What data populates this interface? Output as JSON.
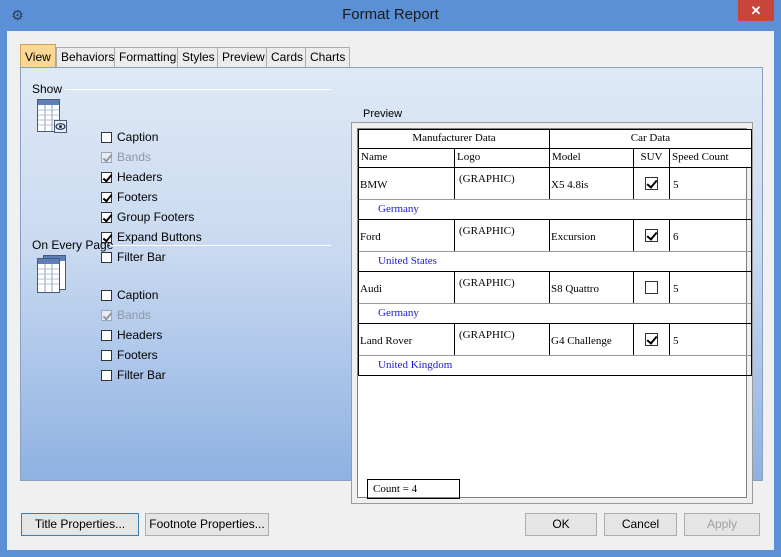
{
  "window": {
    "title": "Format Report",
    "close_glyph": "✕",
    "app_icon": "gear-icon"
  },
  "tabs": [
    {
      "label": "View"
    },
    {
      "label": "Behaviors"
    },
    {
      "label": "Formatting"
    },
    {
      "label": "Styles"
    },
    {
      "label": "Preview"
    },
    {
      "label": "Cards"
    },
    {
      "label": "Charts"
    }
  ],
  "show": {
    "label": "Show",
    "items": [
      {
        "label": "Caption",
        "checked": false,
        "disabled": false
      },
      {
        "label": "Bands",
        "checked": true,
        "disabled": true
      },
      {
        "label": "Headers",
        "checked": true,
        "disabled": false
      },
      {
        "label": "Footers",
        "checked": true,
        "disabled": false
      },
      {
        "label": "Group Footers",
        "checked": true,
        "disabled": false
      },
      {
        "label": "Expand Buttons",
        "checked": true,
        "disabled": false
      },
      {
        "label": "Filter Bar",
        "checked": false,
        "disabled": false
      }
    ]
  },
  "every_page": {
    "label": "On Every Page",
    "items": [
      {
        "label": "Caption",
        "checked": false,
        "disabled": false
      },
      {
        "label": "Bands",
        "checked": true,
        "disabled": true
      },
      {
        "label": "Headers",
        "checked": false,
        "disabled": false
      },
      {
        "label": "Footers",
        "checked": false,
        "disabled": false
      },
      {
        "label": "Filter Bar",
        "checked": false,
        "disabled": false
      }
    ]
  },
  "preview": {
    "label": "Preview",
    "bands": [
      "Manufacturer Data",
      "Car Data"
    ],
    "columns": [
      "Name",
      "Logo",
      "Model",
      "SUV",
      "Speed Count"
    ],
    "rows": [
      {
        "name": "BMW",
        "logo": "(GRAPHIC)",
        "model": "X5 4.8is",
        "suv": true,
        "speed": "5",
        "country": "Germany"
      },
      {
        "name": "Ford",
        "logo": "(GRAPHIC)",
        "model": "Excursion",
        "suv": true,
        "speed": "6",
        "country": "United States"
      },
      {
        "name": "Audi",
        "logo": "(GRAPHIC)",
        "model": "S8 Quattro",
        "suv": false,
        "speed": "5",
        "country": "Germany"
      },
      {
        "name": "Land Rover",
        "logo": "(GRAPHIC)",
        "model": "G4 Challenge",
        "suv": true,
        "speed": "5",
        "country": "United Kingdom"
      }
    ],
    "footer": "Count = 4"
  },
  "buttons": {
    "title_props": "Title Properties...",
    "footnote_props": "Footnote Properties...",
    "ok": "OK",
    "cancel": "Cancel",
    "apply": "Apply"
  }
}
